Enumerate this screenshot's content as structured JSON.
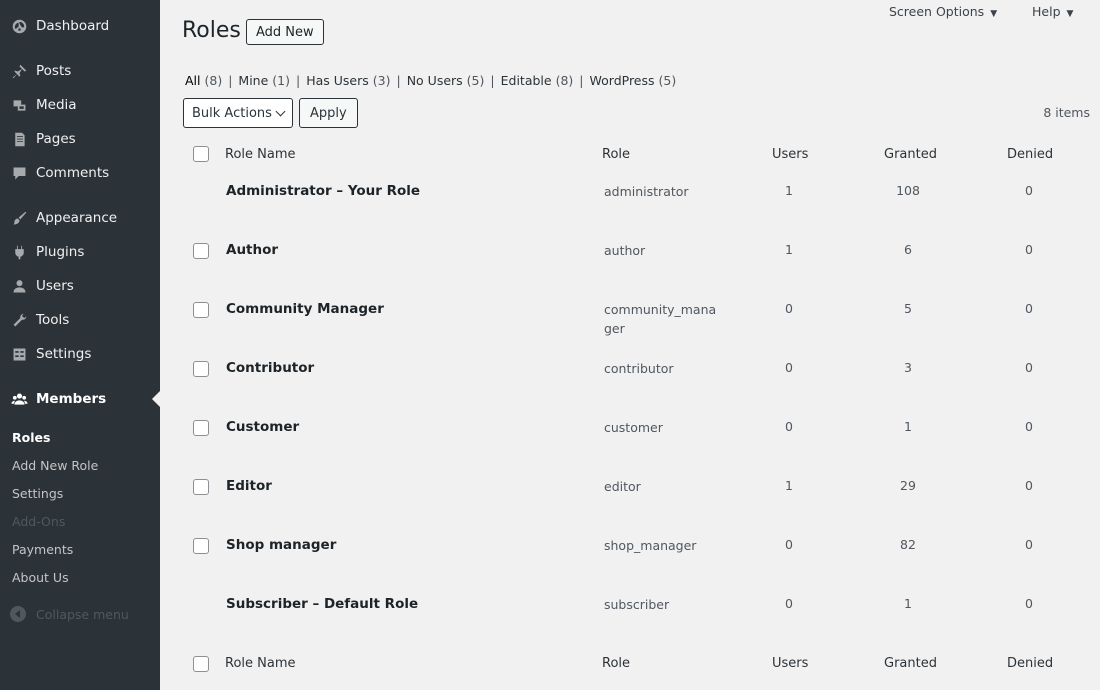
{
  "sidebar": {
    "items": [
      {
        "label": "Dashboard",
        "icon": "dashboard-icon"
      },
      {
        "label": "Posts",
        "icon": "pin-icon"
      },
      {
        "label": "Media",
        "icon": "media-icon"
      },
      {
        "label": "Pages",
        "icon": "pages-icon"
      },
      {
        "label": "Comments",
        "icon": "comment-icon"
      },
      {
        "label": "Appearance",
        "icon": "brush-icon"
      },
      {
        "label": "Plugins",
        "icon": "plug-icon"
      },
      {
        "label": "Users",
        "icon": "users-icon"
      },
      {
        "label": "Tools",
        "icon": "wrench-icon"
      },
      {
        "label": "Settings",
        "icon": "settings-icon"
      },
      {
        "label": "Members",
        "icon": "groups-icon"
      }
    ],
    "submenu": [
      "Roles",
      "Add New Role",
      "Settings",
      "Add-Ons",
      "Payments",
      "About Us"
    ],
    "collapse_label": "Collapse menu"
  },
  "header": {
    "screen_options": "Screen Options",
    "help": "Help",
    "title": "Roles",
    "add_new": "Add New"
  },
  "filters": [
    {
      "label": "All",
      "count": "(8)"
    },
    {
      "label": "Mine",
      "count": "(1)"
    },
    {
      "label": "Has Users",
      "count": "(3)"
    },
    {
      "label": "No Users",
      "count": "(5)"
    },
    {
      "label": "Editable",
      "count": "(8)"
    },
    {
      "label": "WordPress",
      "count": "(5)"
    }
  ],
  "toolbar": {
    "bulk_actions": "Bulk Actions",
    "apply": "Apply",
    "items_count": "8 items"
  },
  "table": {
    "columns": [
      "Role Name",
      "Role",
      "Users",
      "Granted",
      "Denied"
    ],
    "rows": [
      {
        "name": "Administrator – Your Role",
        "role": "administrator",
        "users": "1",
        "granted": "108",
        "denied": "0",
        "checkbox": false
      },
      {
        "name": "Author",
        "role": "author",
        "users": "1",
        "granted": "6",
        "denied": "0",
        "checkbox": true
      },
      {
        "name": "Community Manager",
        "role": "community_manager",
        "users": "0",
        "granted": "5",
        "denied": "0",
        "checkbox": true
      },
      {
        "name": "Contributor",
        "role": "contributor",
        "users": "0",
        "granted": "3",
        "denied": "0",
        "checkbox": true
      },
      {
        "name": "Customer",
        "role": "customer",
        "users": "0",
        "granted": "1",
        "denied": "0",
        "checkbox": true
      },
      {
        "name": "Editor",
        "role": "editor",
        "users": "1",
        "granted": "29",
        "denied": "0",
        "checkbox": true
      },
      {
        "name": "Shop manager",
        "role": "shop_manager",
        "users": "0",
        "granted": "82",
        "denied": "0",
        "checkbox": true
      },
      {
        "name": "Subscriber – Default Role",
        "role": "subscriber",
        "users": "0",
        "granted": "1",
        "denied": "0",
        "checkbox": false
      }
    ]
  },
  "colors": {
    "sidebar_bg": "#2c3338",
    "page_bg": "#f1f1f1"
  }
}
